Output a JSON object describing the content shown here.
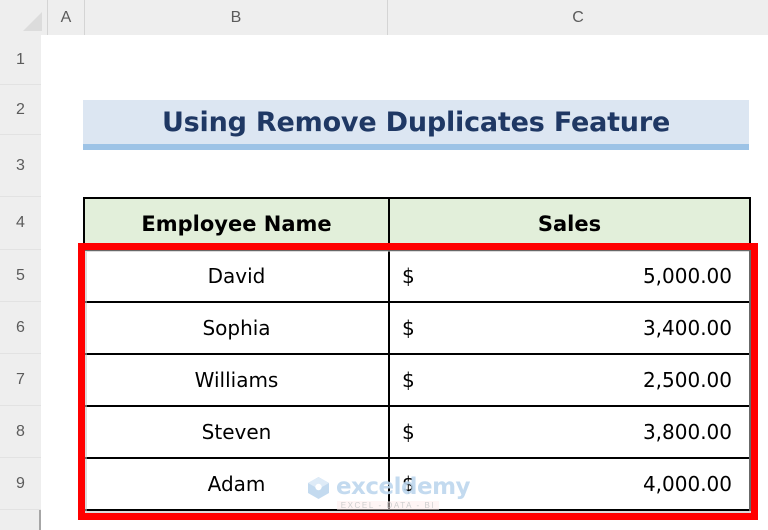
{
  "app": {
    "type": "spreadsheet",
    "select_all_label": "",
    "select_all_icon": "select-all-triangle-icon"
  },
  "columns": [
    {
      "label": "A"
    },
    {
      "label": "B"
    },
    {
      "label": "C"
    }
  ],
  "rows": [
    {
      "label": "1"
    },
    {
      "label": "2"
    },
    {
      "label": "3"
    },
    {
      "label": "4"
    },
    {
      "label": "5"
    },
    {
      "label": "6"
    },
    {
      "label": "7"
    },
    {
      "label": "8"
    },
    {
      "label": "9"
    }
  ],
  "title_banner": {
    "text": "Using Remove Duplicates Feature",
    "background": "#dce6f2",
    "underline_color": "#9dc3e6",
    "text_color": "#1f3864"
  },
  "table": {
    "headers": [
      "Employee Name",
      "Sales"
    ],
    "header_background": "#e2efda",
    "rows": [
      {
        "name": "David",
        "currency": "$",
        "amount": "5,000.00"
      },
      {
        "name": "Sophia",
        "currency": "$",
        "amount": "3,400.00"
      },
      {
        "name": "Williams",
        "currency": "$",
        "amount": "2,500.00"
      },
      {
        "name": "Steven",
        "currency": "$",
        "amount": "3,800.00"
      },
      {
        "name": "Adam",
        "currency": "$",
        "amount": "4,000.00"
      }
    ]
  },
  "annotation": {
    "type": "red-rectangle-highlight",
    "color": "#ff0000",
    "covers": "B5:C9"
  },
  "watermark": {
    "word": "exceldemy",
    "tagline": "EXCEL - DATA - BI",
    "color": "#bdd7ee"
  }
}
